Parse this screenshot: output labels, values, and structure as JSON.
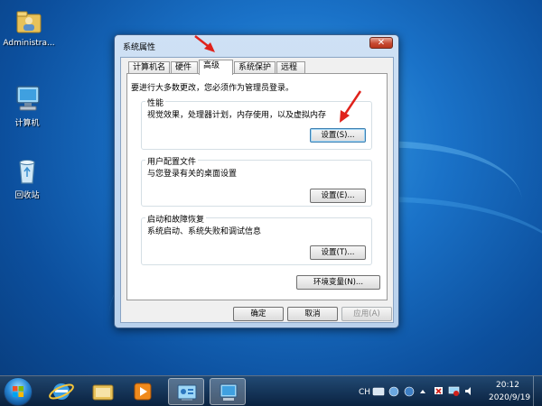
{
  "desktop": {
    "icons": [
      {
        "label": "Administra..."
      },
      {
        "label": "计算机"
      },
      {
        "label": "回收站"
      }
    ]
  },
  "dialog": {
    "title": "系统属性",
    "close_label": "✕",
    "tabs": [
      "计算机名",
      "硬件",
      "高级",
      "系统保护",
      "远程"
    ],
    "active_tab": "高级",
    "intro": "要进行大多数更改，您必须作为管理员登录。",
    "groups": [
      {
        "title": "性能",
        "description": "视觉效果，处理器计划，内存使用，以及虚拟内存",
        "button": "设置(S)..."
      },
      {
        "title": "用户配置文件",
        "description": "与您登录有关的桌面设置",
        "button": "设置(E)..."
      },
      {
        "title": "启动和故障恢复",
        "description": "系统启动、系统失败和调试信息",
        "button": "设置(T)..."
      }
    ],
    "env_button": "环境变量(N)...",
    "ok_button": "确定",
    "cancel_button": "取消",
    "apply_button": "应用(A)"
  },
  "taskbar": {
    "language": "CH",
    "time": "20:12",
    "date": "2020/9/19"
  },
  "colors": {
    "annotation_arrow": "#e0221b",
    "wallpaper": "#1a72c8"
  }
}
